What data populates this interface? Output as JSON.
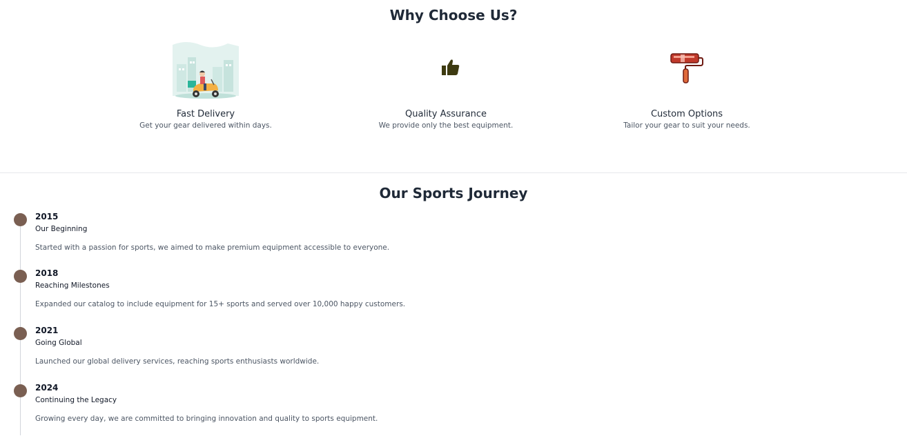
{
  "why": {
    "heading": "Why Choose Us?",
    "features": [
      {
        "title": "Fast Delivery",
        "text": "Get your gear delivered within days.",
        "icon": "delivery-scooter-illustration"
      },
      {
        "title": "Quality Assurance",
        "text": "We provide only the best equipment.",
        "icon": "thumbs-up-icon"
      },
      {
        "title": "Custom Options",
        "text": "Tailor your gear to suit your needs.",
        "icon": "paint-roller-icon"
      }
    ]
  },
  "journey": {
    "heading": "Our Sports Journey",
    "items": [
      {
        "year": "2015",
        "title": "Our Beginning",
        "text": "Started with a passion for sports, we aimed to make premium equipment accessible to everyone."
      },
      {
        "year": "2018",
        "title": "Reaching Milestones",
        "text": "Expanded our catalog to include equipment for 15+ sports and served over 10,000 happy customers."
      },
      {
        "year": "2021",
        "title": "Going Global",
        "text": "Launched our global delivery services, reaching sports enthusiasts worldwide."
      },
      {
        "year": "2024",
        "title": "Continuing the Legacy",
        "text": "Growing every day, we are committed to bringing innovation and quality to sports equipment."
      }
    ]
  },
  "colors": {
    "timeline_dot": "#7a5f52",
    "heading": "#1f2937",
    "body_text": "#4b5563"
  }
}
